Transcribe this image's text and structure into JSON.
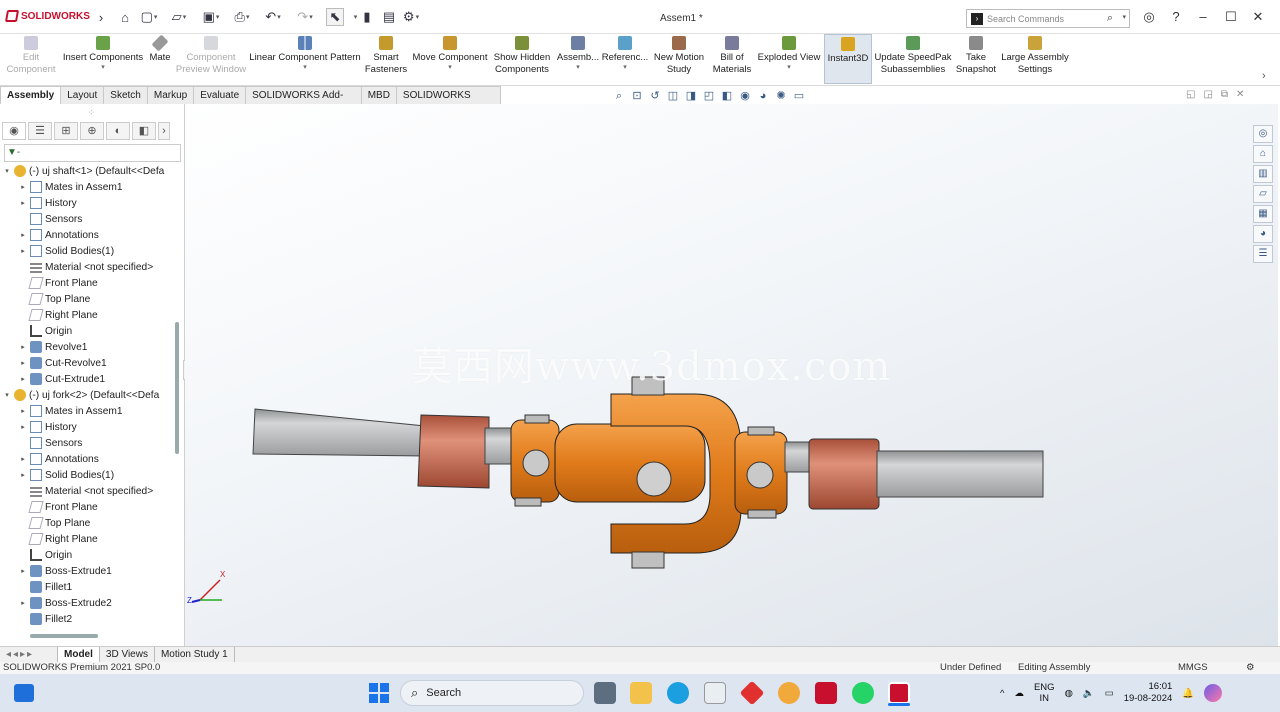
{
  "app": {
    "logo": "SOLIDWORKS",
    "doc_title": "Assem1 *"
  },
  "search": {
    "placeholder": "Search Commands"
  },
  "ribbon": [
    {
      "label": "Edit\nComponent",
      "disabled": true
    },
    {
      "label": "Insert Components",
      "dd": true
    },
    {
      "label": "Mate"
    },
    {
      "label": "Component\nPreview Window",
      "disabled": true
    },
    {
      "label": "Linear Component Pattern",
      "dd": true
    },
    {
      "label": "Smart\nFasteners"
    },
    {
      "label": "Move Component",
      "dd": true
    },
    {
      "label": "Show Hidden\nComponents"
    },
    {
      "label": "Assemb...",
      "dd": true
    },
    {
      "label": "Referenc...",
      "dd": true
    },
    {
      "label": "New Motion\nStudy"
    },
    {
      "label": "Bill of\nMaterials"
    },
    {
      "label": "Exploded View",
      "dd": true
    },
    {
      "label": "Instant3D",
      "active": true
    },
    {
      "label": "Update SpeedPak\nSubassemblies"
    },
    {
      "label": "Take\nSnapshot"
    },
    {
      "label": "Large Assembly\nSettings"
    }
  ],
  "tabs": [
    "Assembly",
    "Layout",
    "Sketch",
    "Markup",
    "Evaluate",
    "SOLIDWORKS Add-Ins",
    "MBD",
    "SOLIDWORKS CAM"
  ],
  "tree": [
    {
      "level": 0,
      "exp": "▾",
      "icon": "part",
      "text": "(-) uj shaft<1> (Default<<Defa"
    },
    {
      "level": 1,
      "exp": "▸",
      "icon": "folder",
      "text": "Mates in Assem1"
    },
    {
      "level": 1,
      "exp": "▸",
      "icon": "folder",
      "text": "History"
    },
    {
      "level": 1,
      "exp": "",
      "icon": "folder",
      "text": "Sensors"
    },
    {
      "level": 1,
      "exp": "▸",
      "icon": "folder",
      "text": "Annotations"
    },
    {
      "level": 1,
      "exp": "▸",
      "icon": "folder",
      "text": "Solid Bodies(1)"
    },
    {
      "level": 1,
      "exp": "",
      "icon": "mat",
      "text": "Material <not specified>"
    },
    {
      "level": 1,
      "exp": "",
      "icon": "plane",
      "text": "Front Plane"
    },
    {
      "level": 1,
      "exp": "",
      "icon": "plane",
      "text": "Top Plane"
    },
    {
      "level": 1,
      "exp": "",
      "icon": "plane",
      "text": "Right Plane"
    },
    {
      "level": 1,
      "exp": "",
      "icon": "orig",
      "text": "Origin"
    },
    {
      "level": 1,
      "exp": "▸",
      "icon": "feat",
      "text": "Revolve1"
    },
    {
      "level": 1,
      "exp": "▸",
      "icon": "feat",
      "text": "Cut-Revolve1"
    },
    {
      "level": 1,
      "exp": "▸",
      "icon": "feat",
      "text": "Cut-Extrude1"
    },
    {
      "level": 0,
      "exp": "▾",
      "icon": "part",
      "text": "(-) uj fork<2> (Default<<Defa"
    },
    {
      "level": 1,
      "exp": "▸",
      "icon": "folder",
      "text": "Mates in Assem1"
    },
    {
      "level": 1,
      "exp": "▸",
      "icon": "folder",
      "text": "History"
    },
    {
      "level": 1,
      "exp": "",
      "icon": "folder",
      "text": "Sensors"
    },
    {
      "level": 1,
      "exp": "▸",
      "icon": "folder",
      "text": "Annotations"
    },
    {
      "level": 1,
      "exp": "▸",
      "icon": "folder",
      "text": "Solid Bodies(1)"
    },
    {
      "level": 1,
      "exp": "",
      "icon": "mat",
      "text": "Material <not specified>"
    },
    {
      "level": 1,
      "exp": "",
      "icon": "plane",
      "text": "Front Plane"
    },
    {
      "level": 1,
      "exp": "",
      "icon": "plane",
      "text": "Top Plane"
    },
    {
      "level": 1,
      "exp": "",
      "icon": "plane",
      "text": "Right Plane"
    },
    {
      "level": 1,
      "exp": "",
      "icon": "orig",
      "text": "Origin"
    },
    {
      "level": 1,
      "exp": "▸",
      "icon": "feat",
      "text": "Boss-Extrude1"
    },
    {
      "level": 1,
      "exp": "",
      "icon": "feat",
      "text": "Fillet1"
    },
    {
      "level": 1,
      "exp": "▸",
      "icon": "feat",
      "text": "Boss-Extrude2"
    },
    {
      "level": 1,
      "exp": "",
      "icon": "feat",
      "text": "Fillet2"
    }
  ],
  "filter_glyph": "▼-",
  "bottom_tabs": [
    "Model",
    "3D Views",
    "Motion Study 1"
  ],
  "status": {
    "left": "SOLIDWORKS Premium 2021 SP0.0",
    "state": "Under Defined",
    "mode": "Editing Assembly",
    "units": "MMGS"
  },
  "watermark": "莫西网www.3dmox.com",
  "triad": {
    "x": "X",
    "z": "Z"
  },
  "taskbar": {
    "search": "Search",
    "lang1": "ENG",
    "lang2": "IN",
    "time": "16:01",
    "date": "19-08-2024"
  },
  "colors": {
    "accent": "#c8102e",
    "part_orange": "#e07b1a",
    "shaft_grey": "#b6b8ba",
    "sleeve_copper": "#c86a4e"
  }
}
